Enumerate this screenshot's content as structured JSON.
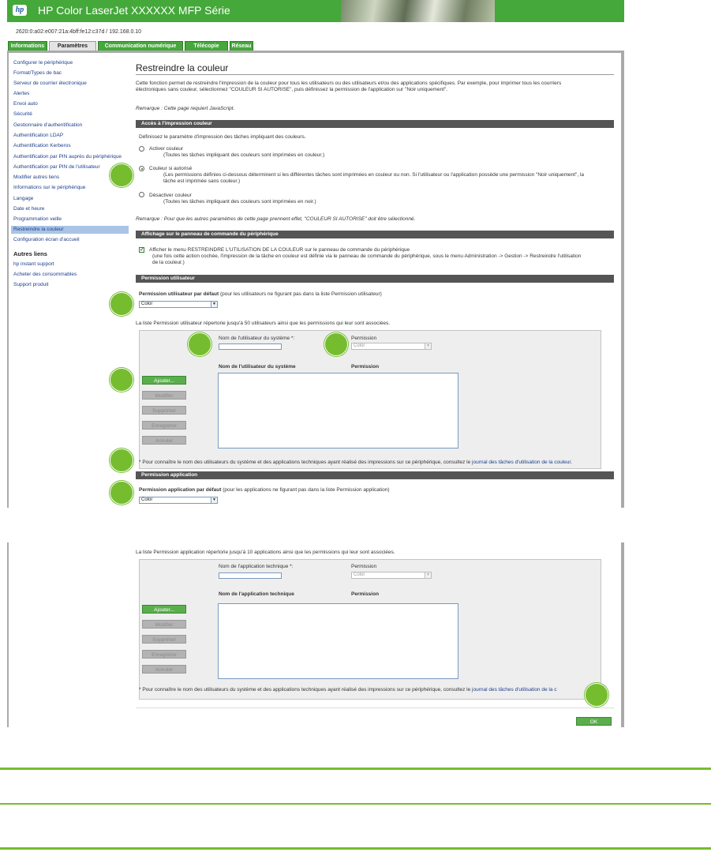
{
  "header": {
    "logo_text": "hp",
    "title": "HP Color LaserJet XXXXXX MFP Série"
  },
  "address": "2620:0:a02:e007:21a:4bff:fe12:c37d / 192.168.0.10",
  "tabs": [
    {
      "label": "Informations"
    },
    {
      "label": "Paramètres"
    },
    {
      "label": "Communication numérique"
    },
    {
      "label": "Télécopie"
    },
    {
      "label": "Réseau"
    }
  ],
  "sidebar": {
    "items": [
      {
        "label": "Configurer le périphérique"
      },
      {
        "label": "Format/Types de bac"
      },
      {
        "label": "Serveur de courrier électronique"
      },
      {
        "label": "Alertes"
      },
      {
        "label": "Envoi auto"
      },
      {
        "label": "Sécurité"
      },
      {
        "label": "Gestionnaire d'authentification"
      },
      {
        "label": "Authentification LDAP"
      },
      {
        "label": "Authentification Kerberos"
      },
      {
        "label": "Authentification par PIN auprès du périphérique"
      },
      {
        "label": "Authentification par PIN de l'utilisateur"
      },
      {
        "label": "Modifier autres liens"
      },
      {
        "label": "Informations sur le périphérique"
      },
      {
        "label": "Langage"
      },
      {
        "label": "Date et heure"
      },
      {
        "label": "Programmation veille"
      },
      {
        "label": "Restreindre la couleur"
      },
      {
        "label": "Configuration écran d'accueil"
      }
    ],
    "other_heading": "Autres liens",
    "other_items": [
      {
        "label": "hp instant support"
      },
      {
        "label": "Acheter des consommables"
      },
      {
        "label": "Support produit"
      }
    ]
  },
  "main": {
    "title": "Restreindre la couleur",
    "intro_line1": "Cette fonction permet de restreindre l'impression de la couleur pour tous les utilisateurs ou des utilisateurs et/ou des applications spécifiques. Par exemple, pour imprimer tous les courriers",
    "intro_line2": "électroniques sans couleur, sélectionnez \"COULEUR SI AUTORISE\", puis définissez la permission de l'application sur \"Noir uniquement\".",
    "remark_js": "Remarque : Cette page requiert JavaScript.",
    "section_access": "Accès à l'impression couleur",
    "access_desc": "Définissez le paramètre d'impression des tâches impliquant des couleurs.",
    "radios": [
      {
        "label": "Activer couleur",
        "desc": "(Toutes les tâches impliquant des couleurs sont imprimées en couleur.)",
        "selected": false
      },
      {
        "label": "Couleur si autorisé",
        "desc": "(Les permissions définies ci-dessous déterminent si les différentes tâches sont imprimées en couleur ou non. Si l'utilisateur ou l'application possède une permission \"Noir uniquement\", la",
        "desc2": "tâche est imprimée sans couleur.)",
        "selected": true
      },
      {
        "label": "Désactiver couleur",
        "desc": "(Toutes les tâches impliquant des couleurs sont imprimées en noir.)",
        "selected": false
      }
    ],
    "remark_other": "Remarque : Pour que les autres paramètres de cette page prennent effet, \"COULEUR SI AUTORISE\" doit être sélectionné.",
    "section_panel": "Affichage sur le panneau de commande du périphérique",
    "panel_check_label": "Afficher le menu RESTREINDRE L'UTILISATION DE LA COULEUR sur le panneau de commande du périphérique",
    "panel_check_desc1": "(une fois cette action cochée, l'impression de la tâche en couleur est définie via le panneau de commande du périphérique, sous le menu Administration -> Gestion -> Restreindre l'utilisation",
    "panel_check_desc2": "de la couleur.)",
    "panel_checked": true,
    "section_user": "Permission utilisateur",
    "user_default_label_bold": "Permission utilisateur par défaut",
    "user_default_label_rest": " (pour les utilisateurs ne figurant pas dans la liste Permission utilisateur)",
    "user_default_value": "Color",
    "user_list_desc": "La liste Permission utilisateur répertorie jusqu'à 50 utilisateurs ainsi que les permissions qui leur sont associées.",
    "user_name_label": "Nom de l'utilisateur du système *:",
    "user_name_value": "",
    "user_perm_label": "Permission",
    "user_perm_value": "Color",
    "user_col_name": "Nom de l'utilisateur du système",
    "user_col_perm": "Permission",
    "buttons": {
      "add": "Ajouter...",
      "modify": "Modifier",
      "delete": "Supprimer",
      "save": "Enregistrer",
      "cancel": "Annuler"
    },
    "footnote_text": "* Pour connaître le nom des utilisateurs du système et des applications techniques ayant réalisé des impressions sur ce périphérique, consultez le",
    "footnote_link": "journal des tâches d'utilisation de la couleur.",
    "section_app": "Permission application",
    "app_default_label_bold": "Permission application par défaut",
    "app_default_label_rest": " (pour les applications ne figurant pas dans la liste Permission application)",
    "app_default_value": "Color"
  },
  "continued": {
    "app_list_desc": "La liste Permission application répertorie jusqu'à 10 applications ainsi que les permissions qui leur sont associées.",
    "app_name_label": "Nom de l'application technique *:",
    "app_name_value": "",
    "app_perm_label": "Permission",
    "app_perm_value": "Color",
    "app_col_name": "Nom de l'application technique",
    "app_col_perm": "Permission",
    "footnote_link_cut": "journal des tâches d'utilisation de la c",
    "ok_label": "OK"
  },
  "colors": {
    "hp_green": "#44a83a",
    "callout_green": "#75bd2f",
    "band_gray": "#555555",
    "link_blue": "#1d3f8c"
  }
}
